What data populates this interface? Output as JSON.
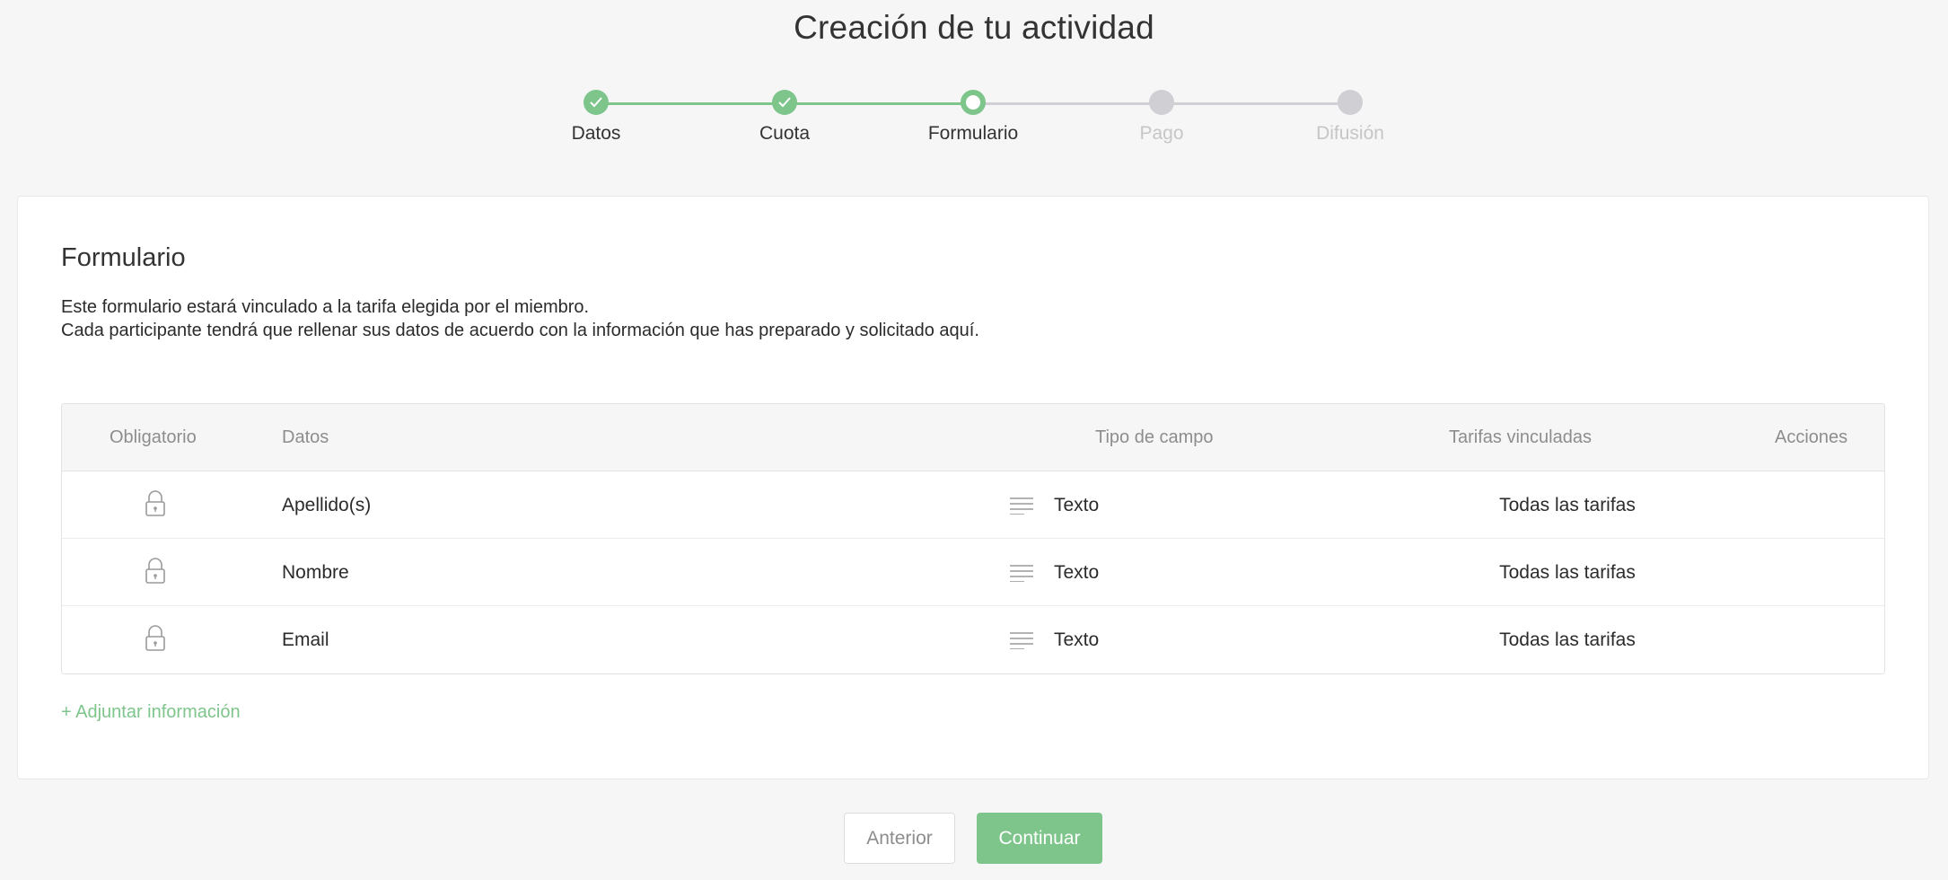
{
  "page": {
    "title": "Creación de tu actividad"
  },
  "stepper": {
    "steps": [
      {
        "label": "Datos",
        "state": "done"
      },
      {
        "label": "Cuota",
        "state": "done"
      },
      {
        "label": "Formulario",
        "state": "current"
      },
      {
        "label": "Pago",
        "state": "pending"
      },
      {
        "label": "Difusión",
        "state": "pending"
      }
    ]
  },
  "form": {
    "title": "Formulario",
    "description_line1": "Este formulario estará vinculado a la tarifa elegida por el miembro.",
    "description_line2": "Cada participante tendrá que rellenar sus datos de acuerdo con la información que has preparado y solicitado aquí.",
    "table": {
      "headers": {
        "obligatorio": "Obligatorio",
        "datos": "Datos",
        "tipo": "Tipo de campo",
        "tarifas": "Tarifas vinculadas",
        "acciones": "Acciones"
      },
      "rows": [
        {
          "dato": "Apellido(s)",
          "tipo": "Texto",
          "tarifas": "Todas las tarifas",
          "icon": "lock-icon",
          "type_icon": "text-lines-icon"
        },
        {
          "dato": "Nombre",
          "tipo": "Texto",
          "tarifas": "Todas las tarifas",
          "icon": "lock-icon",
          "type_icon": "text-lines-icon"
        },
        {
          "dato": "Email",
          "tipo": "Texto",
          "tarifas": "Todas las tarifas",
          "icon": "lock-icon",
          "type_icon": "text-lines-icon"
        }
      ]
    },
    "add_link": "+ Adjuntar información"
  },
  "actions": {
    "prev_label": "Anterior",
    "next_label": "Continuar"
  },
  "colors": {
    "accent": "#7ec58c",
    "pending": "#cfcfd4",
    "background": "#f6f6f6"
  }
}
